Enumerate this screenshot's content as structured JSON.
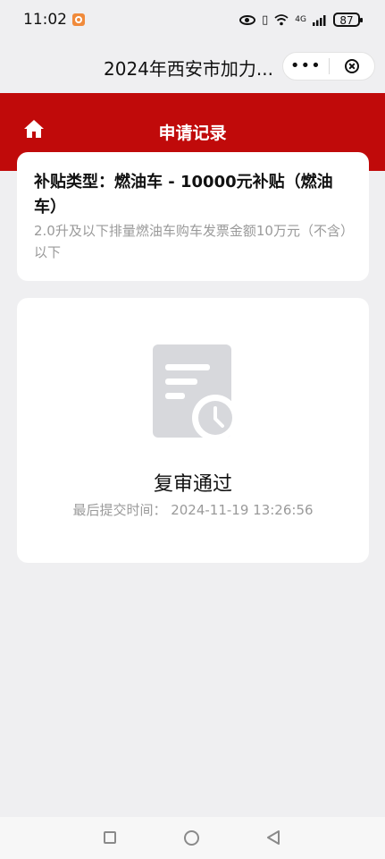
{
  "status_bar": {
    "time": "11:02",
    "network": "4G",
    "battery": "87"
  },
  "title_bar": {
    "title": "2024年西安市加力...",
    "more_label": "•••"
  },
  "header": {
    "title": "申请记录"
  },
  "application": {
    "subsidy_type": "补贴类型：燃油车 - 10000元补贴（燃油车）",
    "description": "2.0升及以下排量燃油车购车发票金额10万元（不含）以下"
  },
  "review": {
    "status": "复审通过",
    "last_submit": "最后提交时间：  2024-11-19 13:26:56"
  },
  "colors": {
    "brand_red": "#c00a0a",
    "background": "#efeff1"
  }
}
